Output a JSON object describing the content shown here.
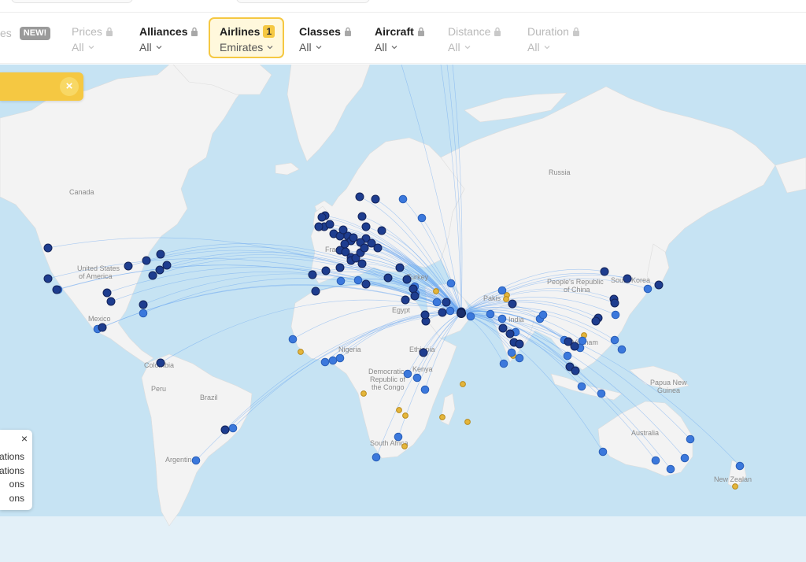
{
  "filters": {
    "partial": {
      "label": "es",
      "badge": "NEW!"
    },
    "prices": {
      "label": "Prices",
      "value": "All"
    },
    "alliances": {
      "label": "Alliances",
      "value": "All"
    },
    "airlines": {
      "label": "Airlines",
      "count": "1",
      "value": "Emirates"
    },
    "classes": {
      "label": "Classes",
      "value": "All"
    },
    "aircraft": {
      "label": "Aircraft",
      "value": "All"
    },
    "distance": {
      "label": "Distance",
      "value": "All"
    },
    "duration": {
      "label": "Duration",
      "value": "All"
    }
  },
  "banner": {
    "close": "×"
  },
  "legend": {
    "close": "×",
    "items": [
      "ations",
      "ations",
      "ons",
      "ons"
    ]
  },
  "map": {
    "labels": {
      "canada": "Canada",
      "usa1": "United States",
      "usa2": "of America",
      "mexico": "Mexico",
      "colombia": "Colombia",
      "peru": "Peru",
      "brazil": "Brazil",
      "argentina": "Argentin",
      "russia": "Russia",
      "france": "France",
      "turkey": "Turkey",
      "egypt": "Egypt",
      "nigeria": "Nigeria",
      "ethiopia": "Ethiopia",
      "kenya": "Kenya",
      "drc1": "Democratic",
      "drc2": "Republic of",
      "drc3": "the Congo",
      "southafrica": "South Africa",
      "pakistan": "Pakis",
      "india": "India",
      "vietnam": "Vietnam",
      "china1": "People's Republic",
      "china2": "of China",
      "korea": "South Korea",
      "png1": "Papua New",
      "png2": "Guinea",
      "australia": "Australia",
      "nz": "New Zealan"
    },
    "colors": {
      "ocean": "#c6e3f3",
      "land": "#f3f3f3",
      "route": "#6aa6f0",
      "hub": "#1b2f6d",
      "dark_dest": "#1e3d8f",
      "light_dest": "#3b78dc",
      "partner": "#e4b53a"
    },
    "hub": "Dubai",
    "destinations": {
      "dark": [
        [
          61,
          315
        ],
        [
          61,
          354
        ],
        [
          72,
          368
        ],
        [
          163,
          338
        ],
        [
          186,
          331
        ],
        [
          204,
          323
        ],
        [
          212,
          337
        ],
        [
          203,
          343
        ],
        [
          194,
          350
        ],
        [
          136,
          372
        ],
        [
          141,
          383
        ],
        [
          182,
          387
        ],
        [
          130,
          416
        ],
        [
          204,
          461
        ],
        [
          286,
          546
        ],
        [
          413,
          274
        ],
        [
          412,
          288
        ],
        [
          405,
          288
        ],
        [
          409,
          276
        ],
        [
          419,
          285
        ],
        [
          424,
          297
        ],
        [
          432,
          300
        ],
        [
          436,
          292
        ],
        [
          442,
          300
        ],
        [
          446,
          306
        ],
        [
          460,
          275
        ],
        [
          457,
          250
        ],
        [
          477,
          253
        ],
        [
          465,
          288
        ],
        [
          485,
          293
        ],
        [
          465,
          303
        ],
        [
          458,
          308
        ],
        [
          449,
          302
        ],
        [
          438,
          310
        ],
        [
          432,
          318
        ],
        [
          439,
          320
        ],
        [
          446,
          327
        ],
        [
          446,
          331
        ],
        [
          452,
          328
        ],
        [
          458,
          321
        ],
        [
          463,
          315
        ],
        [
          472,
          309
        ],
        [
          480,
          315
        ],
        [
          460,
          335
        ],
        [
          432,
          340
        ],
        [
          414,
          344
        ],
        [
          397,
          349
        ],
        [
          401,
          370
        ],
        [
          465,
          361
        ],
        [
          493,
          353
        ],
        [
          508,
          340
        ],
        [
          517,
          355
        ],
        [
          525,
          367
        ],
        [
          527,
          376
        ],
        [
          515,
          381
        ],
        [
          541,
          408
        ],
        [
          540,
          400
        ],
        [
          562,
          397
        ],
        [
          586,
          396
        ],
        [
          567,
          384
        ],
        [
          538,
          448
        ],
        [
          651,
          386
        ],
        [
          639,
          417
        ],
        [
          648,
          424
        ],
        [
          653,
          435
        ],
        [
          660,
          437
        ],
        [
          722,
          434
        ],
        [
          730,
          440
        ],
        [
          724,
          466
        ],
        [
          731,
          471
        ],
        [
          760,
          404
        ],
        [
          757,
          408
        ],
        [
          780,
          380
        ],
        [
          781,
          385
        ],
        [
          768,
          345
        ],
        [
          797,
          354
        ],
        [
          837,
          362
        ]
      ],
      "light": [
        [
          74,
          368
        ],
        [
          182,
          398
        ],
        [
          124,
          418
        ],
        [
          296,
          544
        ],
        [
          249,
          585
        ],
        [
          433,
          357
        ],
        [
          455,
          356
        ],
        [
          528,
          373
        ],
        [
          536,
          277
        ],
        [
          512,
          253
        ],
        [
          527,
          364
        ],
        [
          555,
          384
        ],
        [
          573,
          360
        ],
        [
          598,
          402
        ],
        [
          623,
          399
        ],
        [
          572,
          395
        ],
        [
          372,
          431
        ],
        [
          413,
          460
        ],
        [
          423,
          458
        ],
        [
          432,
          455
        ],
        [
          518,
          475
        ],
        [
          530,
          480
        ],
        [
          540,
          495
        ],
        [
          506,
          555
        ],
        [
          478,
          581
        ],
        [
          638,
          369
        ],
        [
          638,
          405
        ],
        [
          640,
          462
        ],
        [
          655,
          422
        ],
        [
          660,
          455
        ],
        [
          650,
          448
        ],
        [
          686,
          405
        ],
        [
          690,
          400
        ],
        [
          717,
          432
        ],
        [
          740,
          433
        ],
        [
          737,
          442
        ],
        [
          781,
          432
        ],
        [
          790,
          444
        ],
        [
          721,
          452
        ],
        [
          739,
          491
        ],
        [
          764,
          500
        ],
        [
          823,
          367
        ],
        [
          782,
          400
        ],
        [
          877,
          558
        ],
        [
          870,
          582
        ],
        [
          852,
          596
        ],
        [
          833,
          585
        ],
        [
          766,
          574
        ],
        [
          940,
          592
        ]
      ],
      "partner": [
        [
          382,
          447
        ],
        [
          462,
          500
        ],
        [
          507,
          521
        ],
        [
          515,
          528
        ],
        [
          514,
          567
        ],
        [
          562,
          530
        ],
        [
          588,
          488
        ],
        [
          594,
          536
        ],
        [
          554,
          370
        ],
        [
          644,
          375
        ],
        [
          643,
          380
        ],
        [
          742,
          426
        ],
        [
          652,
          452
        ],
        [
          934,
          618
        ]
      ]
    }
  }
}
